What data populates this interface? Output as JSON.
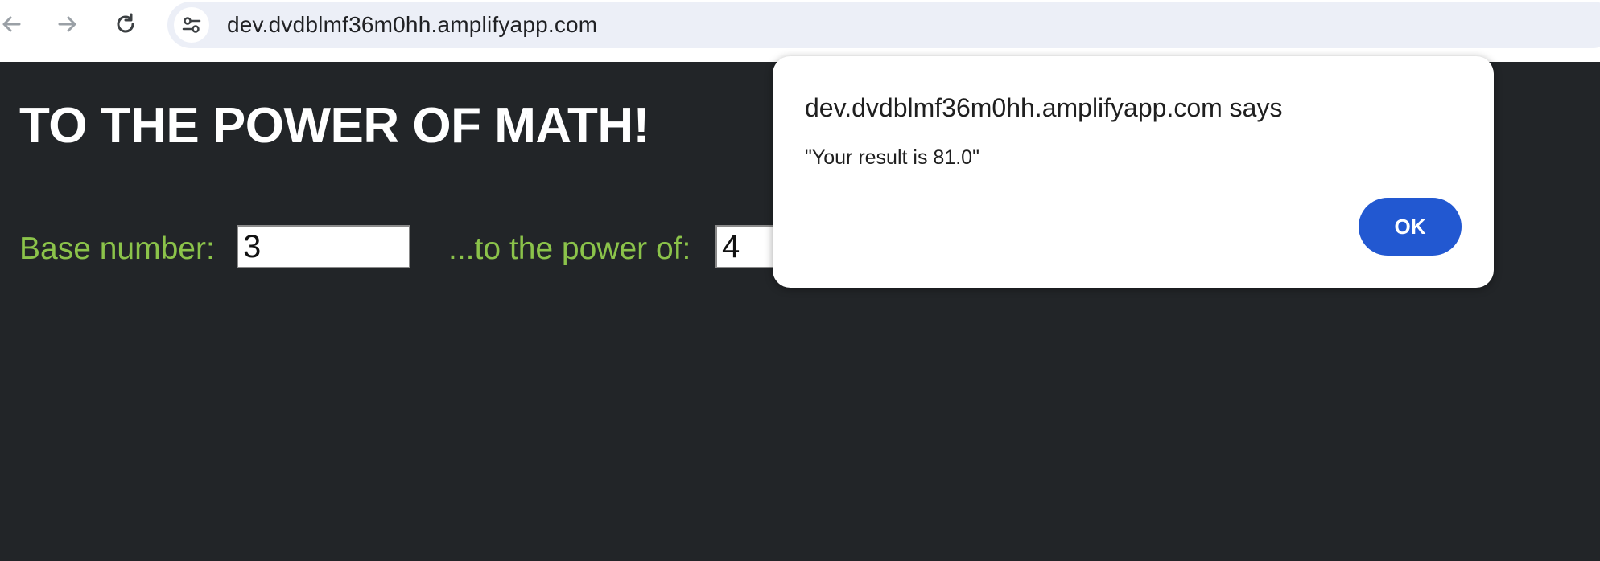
{
  "browser": {
    "url": "dev.dvdblmf36m0hh.amplifyapp.com",
    "icons": [
      "back-arrow-icon",
      "forward-arrow-icon",
      "reload-icon",
      "site-info-tune-icon"
    ]
  },
  "page": {
    "title": "TO THE POWER OF MATH!",
    "base_label": "Base number:",
    "base_value": "3",
    "power_label": "...to the power of:",
    "power_value": "4",
    "label_color": "#8bc34a",
    "background_color": "#222528"
  },
  "dialog": {
    "title": "dev.dvdblmf36m0hh.amplifyapp.com says",
    "message": "\"Your result is 81.0\"",
    "ok_label": "OK",
    "button_color": "#2258d1"
  }
}
